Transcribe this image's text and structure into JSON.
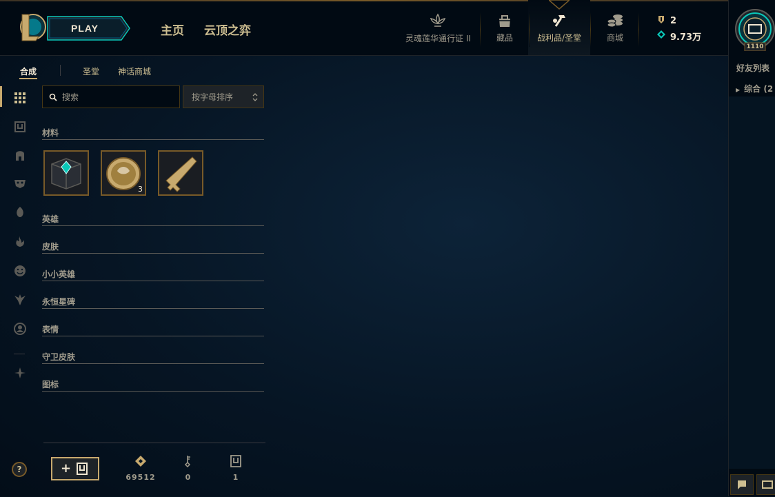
{
  "header": {
    "play_label": "PLAY",
    "tabs": [
      {
        "label": "主页"
      },
      {
        "label": "云顶之弈"
      }
    ],
    "icons": [
      {
        "label": "灵魂莲华通行证 II",
        "icon": "lotus-icon"
      },
      {
        "label": "藏品",
        "icon": "collection-bag-icon"
      },
      {
        "label": "战利品/圣堂",
        "icon": "hammer-icon"
      },
      {
        "label": "商城",
        "icon": "coins-icon"
      }
    ],
    "currency": {
      "chests": "2",
      "blue_essence": "9.73万"
    },
    "level": "1110"
  },
  "friends": {
    "title": "好友列表",
    "group": "综合 (2"
  },
  "subnav": {
    "tabs": [
      "合成",
      "圣堂",
      "神话商城"
    ]
  },
  "search": {
    "placeholder": "搜索",
    "sort_value": "按字母排序"
  },
  "categories": [
    "材料",
    "英雄",
    "皮肤",
    "小小英雄",
    "永恒星碑",
    "表情",
    "守卫皮肤",
    "图标"
  ],
  "materials": [
    {
      "icon": "hextech-chest-icon",
      "count": ""
    },
    {
      "icon": "gold-token-icon",
      "count": "3"
    },
    {
      "icon": "key-icon",
      "count": ""
    }
  ],
  "footer": {
    "help": "?",
    "add_chest": "+",
    "orange_essence": "69512",
    "keys": "0",
    "chests": "1"
  },
  "colors": {
    "gold": "#c8aa6e",
    "dark_gold": "#785a28",
    "blue_essence": "#0ac8b9",
    "text": "#a09b8c"
  }
}
